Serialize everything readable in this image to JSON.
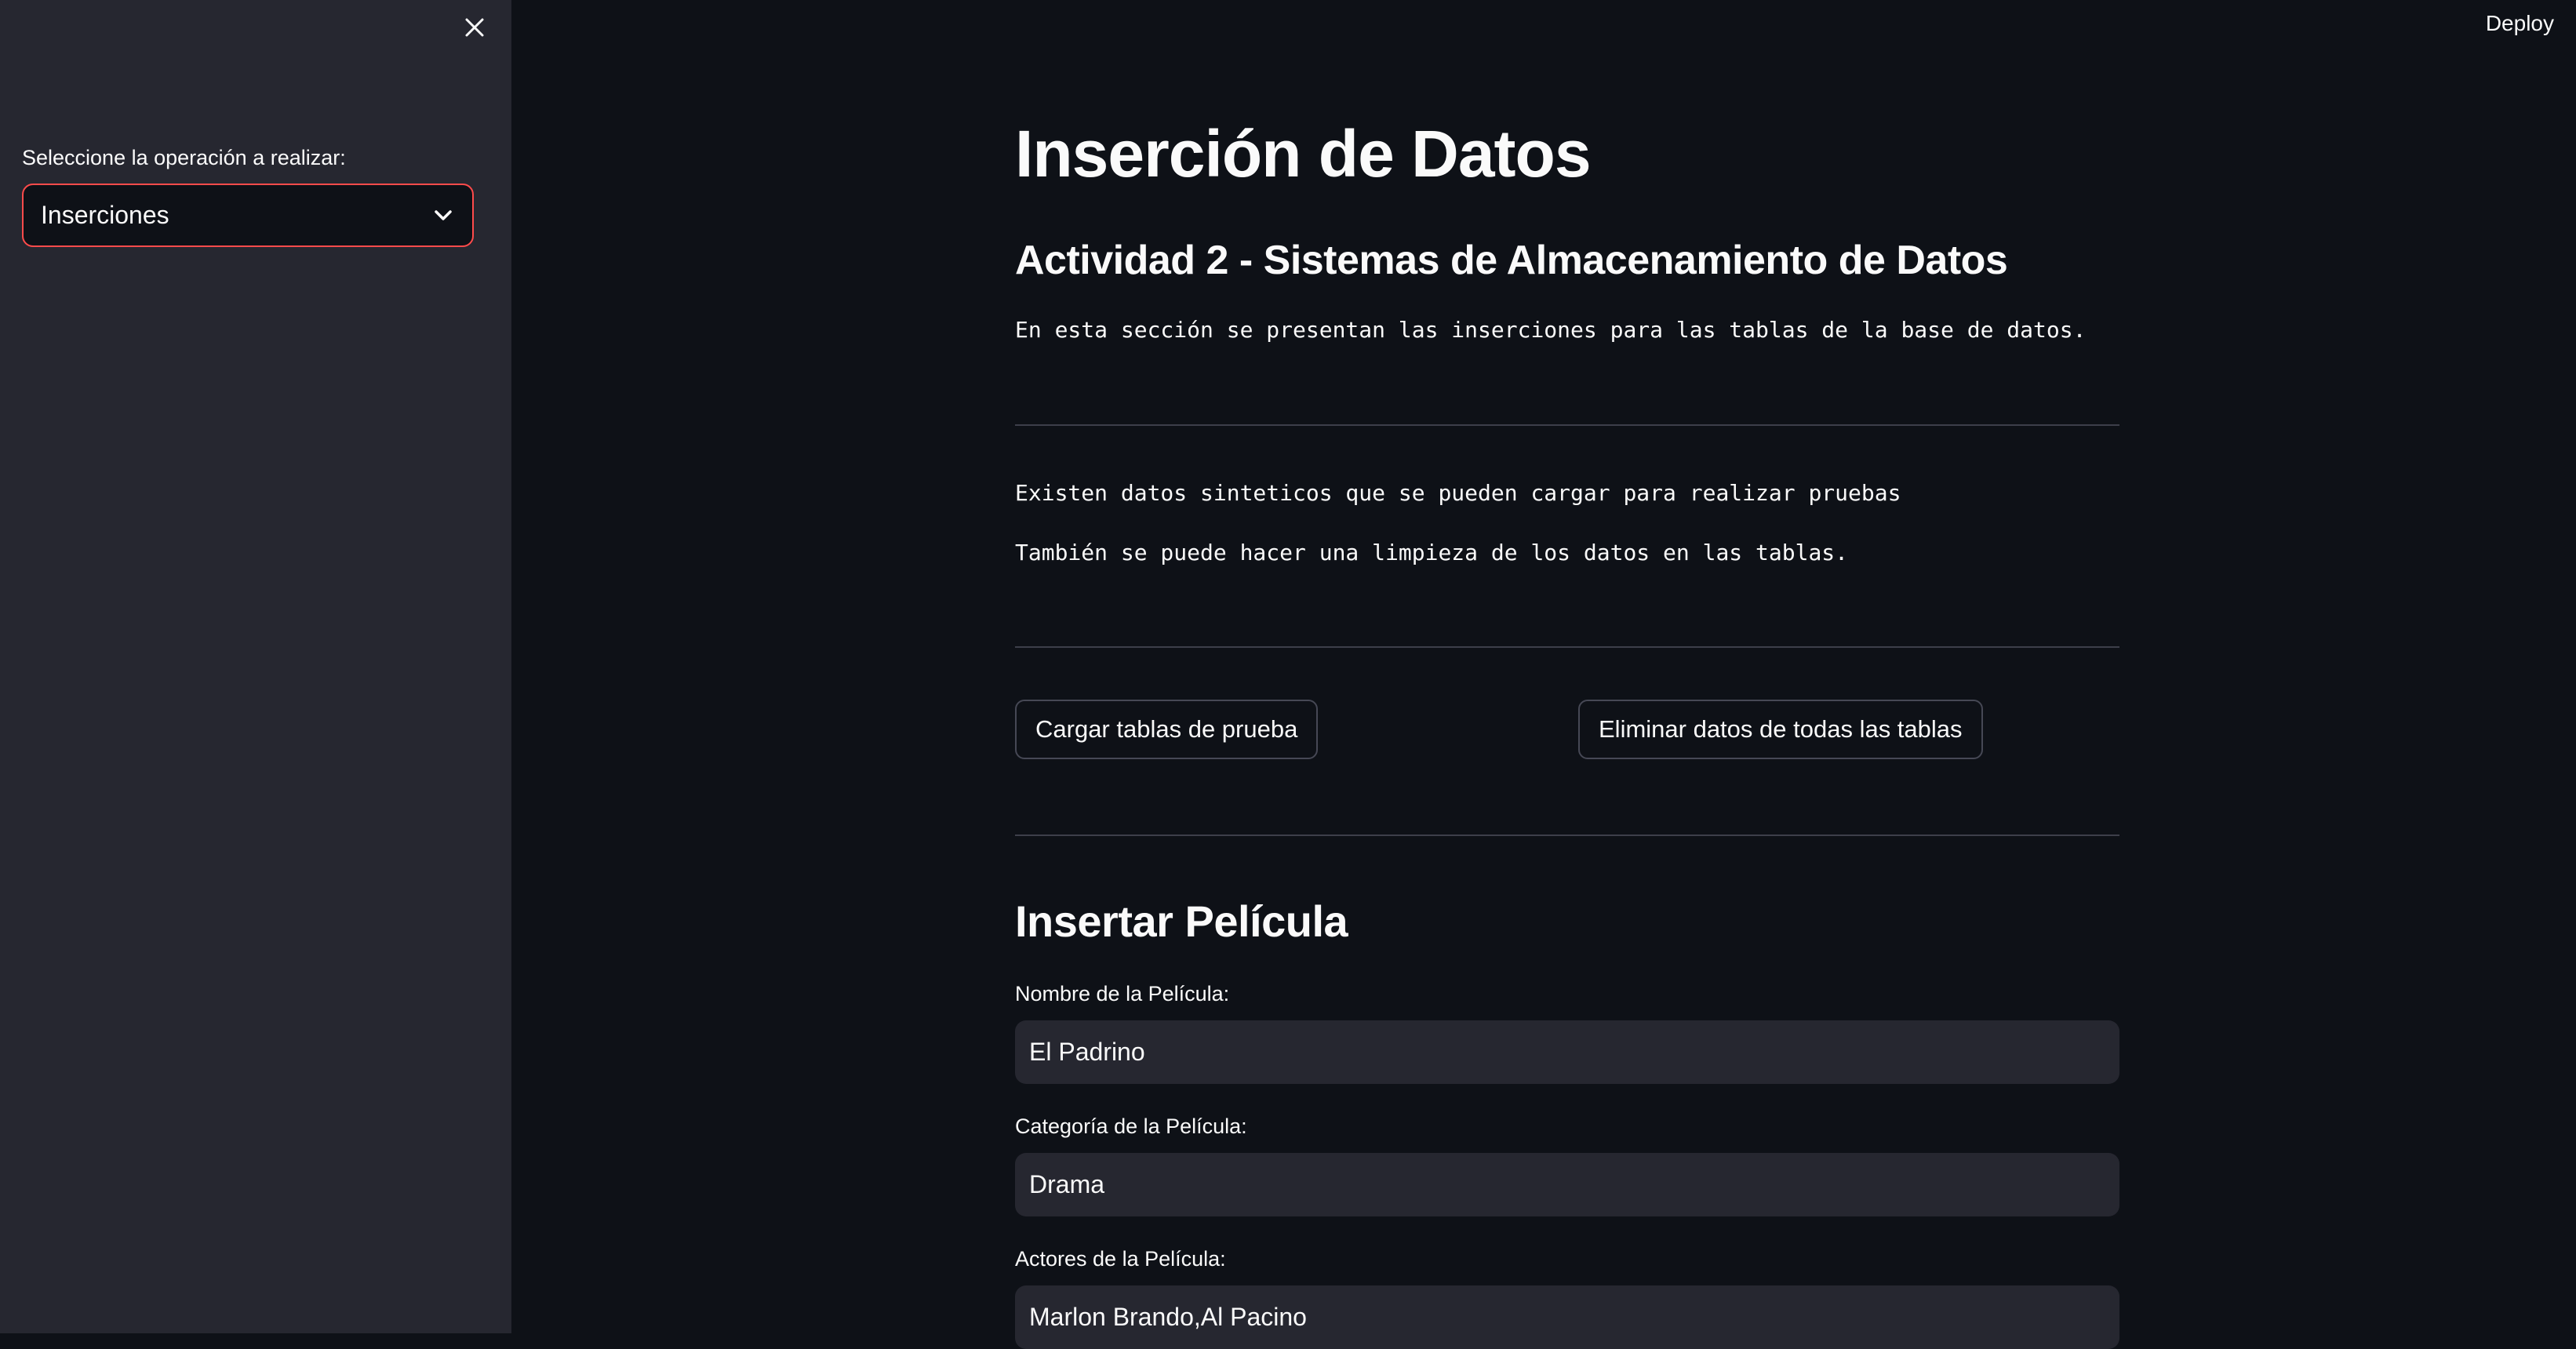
{
  "header": {
    "deploy_label": "Deploy"
  },
  "sidebar": {
    "close_icon": "close-icon",
    "select_label": "Seleccione la operación a realizar:",
    "select_value": "Inserciones",
    "select_icon": "chevron-down-icon"
  },
  "main": {
    "title": "Inserción de Datos",
    "subtitle": "Actividad 2 - Sistemas de Almacenamiento de Datos",
    "intro": "En esta sección se presentan las inserciones para las tablas de la base de datos.",
    "info_line_1": "Existen datos sinteticos que se pueden cargar para realizar pruebas",
    "info_line_2": "También se puede hacer una limpieza de los datos en las tablas.",
    "load_button": "Cargar tablas de prueba",
    "delete_button": "Eliminar datos de todas las tablas",
    "form": {
      "title": "Insertar Película",
      "fields": [
        {
          "label": "Nombre de la Película:",
          "value": "El Padrino"
        },
        {
          "label": "Categoría de la Película:",
          "value": "Drama"
        },
        {
          "label": "Actores de la Película:",
          "value": "Marlon Brando,Al Pacino"
        }
      ]
    }
  },
  "colors": {
    "background": "#0e1117",
    "sidebar": "#262730",
    "accent": "#ff4b4b",
    "input_bg": "#262730",
    "text": "#fafafa"
  }
}
